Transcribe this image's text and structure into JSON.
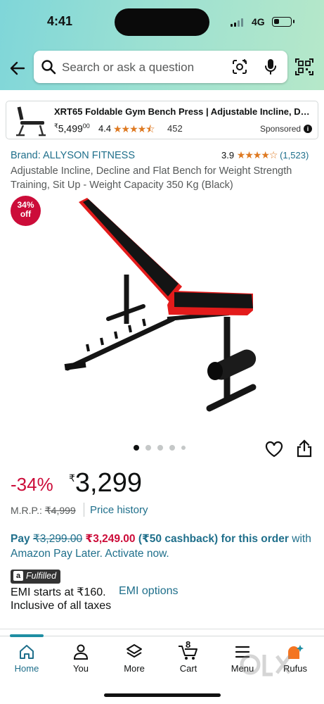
{
  "status_bar": {
    "time": "4:41",
    "network": "4G"
  },
  "search": {
    "placeholder": "Search or ask a question"
  },
  "sponsored_card": {
    "title": "XRT65 Foldable Gym Bench Press | Adjustable Incline, Declin...",
    "price_symbol": "₹",
    "price": "5,499",
    "price_fraction": "00",
    "rating": "4.4",
    "stars": "★★★★⯪",
    "review_count": "452",
    "label": "Sponsored"
  },
  "product": {
    "brand": "Brand: ALLYSON FITNESS",
    "rating": "3.9",
    "stars": "★★★★☆",
    "rating_count": "(1,523)",
    "title": "Adjustable Incline, Decline and Flat Bench for Weight Strength Training, Sit Up - Weight Capacity 350 Kg (Black)",
    "discount_badge_pct": "34%",
    "discount_badge_off": "off",
    "image_count": 5,
    "active_image": 1
  },
  "pricing": {
    "discount": "-34%",
    "currency": "₹",
    "price": "3,299",
    "mrp_label": "M.R.P.:",
    "mrp": "₹4,999",
    "price_history": "Price history"
  },
  "offer": {
    "pay": "Pay",
    "old": "₹3,299.00",
    "new": "₹3,249.00",
    "cashback": "(₹50 cashback) for this order",
    "rest": "with Amazon Pay Later. Activate now."
  },
  "fulfillment": {
    "badge_letter": "a",
    "badge": "Fulfilled",
    "emi": "EMI starts at ₹160.",
    "emi_link": "EMI options",
    "taxes": "Inclusive of all taxes"
  },
  "tabbar": {
    "home": "Home",
    "you": "You",
    "more": "More",
    "cart": "Cart",
    "cart_count": "8",
    "menu": "Menu",
    "rufus": "Rufus"
  },
  "colors": {
    "header_gradient_start": "#7fd6d9",
    "header_gradient_end": "#b6e8c9",
    "deal_red": "#cc0c39",
    "link_blue": "#1f6f8b",
    "star_orange": "#de7921",
    "bench_red": "#e31b1b"
  }
}
